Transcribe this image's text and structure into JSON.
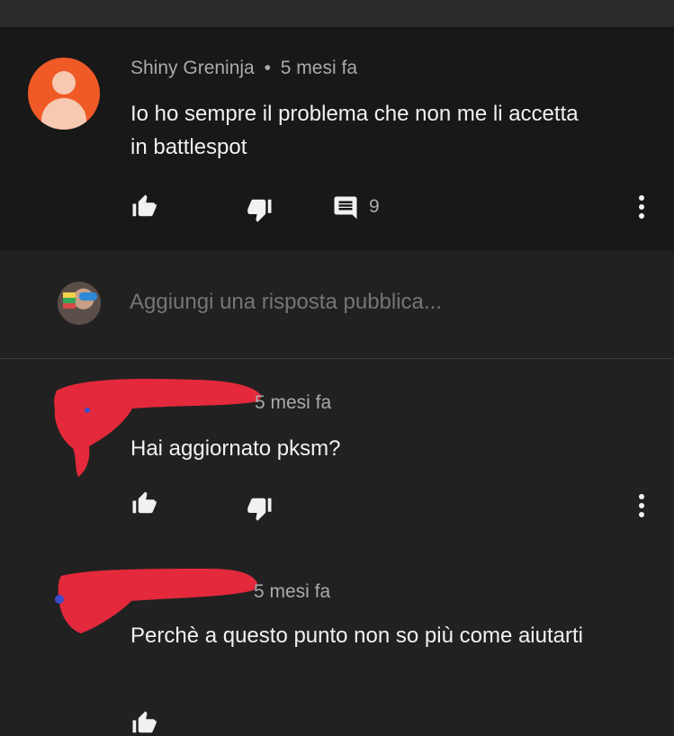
{
  "comment": {
    "author": "Shiny Greninja",
    "time": "5 mesi fa",
    "separator": "•",
    "text": "Io ho sempre il problema che non me li accetta in battlespot",
    "reply_count": "9",
    "avatar_color": "#ef5a27"
  },
  "reply_box": {
    "placeholder": "Aggiungi una risposta pubblica..."
  },
  "replies": [
    {
      "time": "5 mesi fa",
      "text": "Hai aggiornato pksm?"
    },
    {
      "time": "5 mesi fa",
      "text": "Perchè a questo punto non so più come aiutarti"
    }
  ],
  "colors": {
    "background": "#212121",
    "comment_background": "#181818",
    "redaction": "#e3293b"
  },
  "icons": [
    "thumb-up-icon",
    "thumb-down-icon",
    "comment-icon",
    "more-vert-icon"
  ]
}
